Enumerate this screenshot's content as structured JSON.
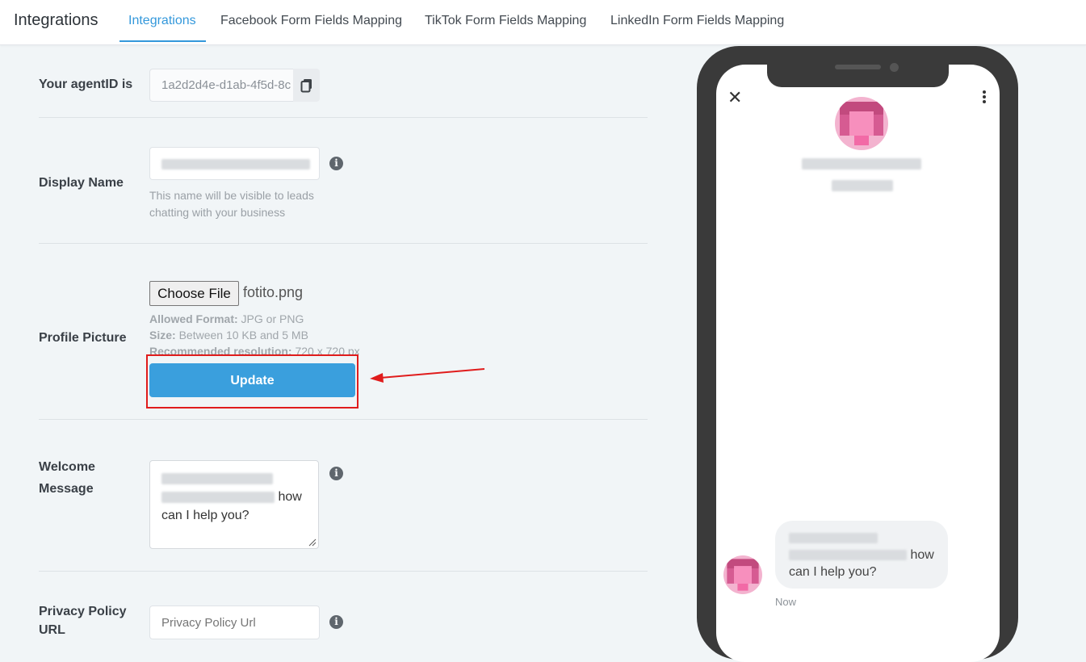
{
  "header": {
    "title": "Integrations",
    "tabs": [
      {
        "label": "Integrations"
      },
      {
        "label": "Facebook Form Fields Mapping"
      },
      {
        "label": "TikTok Form Fields Mapping"
      },
      {
        "label": "LinkedIn Form Fields Mapping"
      }
    ],
    "active_tab": "Integrations"
  },
  "form": {
    "agent_id_label": "Your agentID is",
    "agent_id_value": "1a2d2d4e-d1ab-4f5d-8c",
    "display_name_label": "Display Name",
    "display_name_hint_line1": "This name will be visible to leads",
    "display_name_hint_line2": "chatting with your business",
    "profile_picture_label": "Profile Picture",
    "choose_file_label": "Choose File",
    "file_name": "fotito.png",
    "allowed_format_key": "Allowed Format:",
    "allowed_format_value": " JPG or PNG",
    "size_key": "Size:",
    "size_value": " Between 10 KB and 5 MB",
    "resolution_key": "Recommended resolution:",
    "resolution_value": " 720 x 720 px",
    "update_label": "Update",
    "welcome_label_line1": "Welcome",
    "welcome_label_line2": "Message",
    "welcome_text_tail1": "how",
    "welcome_text_tail2": "can I help you?",
    "privacy_label_line1": "Privacy Policy",
    "privacy_label_line2": "URL",
    "privacy_placeholder": "Privacy Policy Url"
  },
  "preview": {
    "close_icon": "close-icon",
    "menu_icon": "kebab-menu-icon",
    "bubble_tail1": "how",
    "bubble_tail2": "can I help you?",
    "timestamp": "Now"
  },
  "colors": {
    "accent": "#3498db",
    "update_button": "#3a9fdd",
    "annotation_red": "#e01c1c",
    "phone_frame": "#3a3a3a"
  }
}
